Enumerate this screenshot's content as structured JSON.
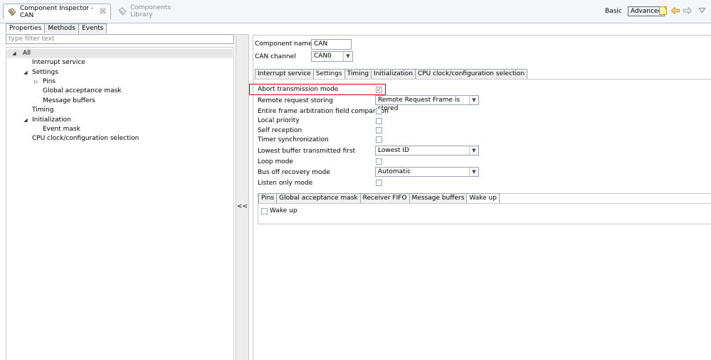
{
  "header": {
    "active_view_tab": "Component Inspector - CAN",
    "active_view_close": "☒",
    "inactive_view_tab": "Components Library",
    "mode_basic": "Basic",
    "mode_advanced": "Advanced",
    "icons": [
      "note-icon",
      "back-arrow-icon",
      "forward-arrow-icon",
      "view-menu-icon"
    ],
    "accent_color": "#6c8ebf"
  },
  "left": {
    "tabs": [
      "Properties",
      "Methods",
      "Events"
    ],
    "filter_placeholder": "type filter text",
    "tree": [
      {
        "label": "All",
        "level": 0,
        "toggle": "◢"
      },
      {
        "label": "Interrupt service",
        "level": 1,
        "toggle": ""
      },
      {
        "label": "Settings",
        "level": 1,
        "toggle": "◢"
      },
      {
        "label": "Pins",
        "level": 2,
        "toggle": "▷"
      },
      {
        "label": "Global acceptance mask",
        "level": 2,
        "toggle": ""
      },
      {
        "label": "Message buffers",
        "level": 2,
        "toggle": ""
      },
      {
        "label": "Timing",
        "level": 1,
        "toggle": ""
      },
      {
        "label": "Initialization",
        "level": 1,
        "toggle": "◢"
      },
      {
        "label": "Event mask",
        "level": 2,
        "toggle": ""
      },
      {
        "label": "CPU clock/configuration selection",
        "level": 1,
        "toggle": ""
      }
    ]
  },
  "splitter": {
    "collapse_label": "<<"
  },
  "right": {
    "component_name_label": "Component name",
    "component_name_value": "CAN",
    "can_channel_label": "CAN channel",
    "can_channel_value": "CAN0",
    "tabs": [
      "Interrupt service",
      "Settings",
      "Timing",
      "Initialization",
      "CPU clock/configuration selection"
    ],
    "selected_tab": "Settings",
    "properties": [
      {
        "label": "Abort transmission mode",
        "type": "checkbox",
        "checked": true,
        "highlighted": true
      },
      {
        "label": "Remote request storing",
        "type": "select",
        "value": "Remote Request Frame is stored"
      },
      {
        "label": "Entire frame arbitration field comparison",
        "type": "checkbox",
        "checked": false
      },
      {
        "label": "Local priority",
        "type": "checkbox",
        "checked": false
      },
      {
        "label": "Self reception",
        "type": "checkbox",
        "checked": false
      },
      {
        "label": "Timer synchronization",
        "type": "checkbox",
        "checked": false
      },
      {
        "label": "Lowest buffer transmitted first",
        "type": "select",
        "value": "Lowest ID"
      },
      {
        "label": "Loop mode",
        "type": "checkbox",
        "checked": false
      },
      {
        "label": "Bus off recovery mode",
        "type": "select",
        "value": "Automatic"
      },
      {
        "label": "Listen only mode",
        "type": "checkbox",
        "checked": false
      }
    ],
    "inner_tabs": [
      "Pins",
      "Global acceptance mask",
      "Receiver FIFO",
      "Message buffers",
      "Wake up"
    ],
    "inner_selected_tab": "Wake up",
    "wake_up_label": "Wake up",
    "check_glyph": "✓",
    "highlight_color": "#d20000"
  }
}
